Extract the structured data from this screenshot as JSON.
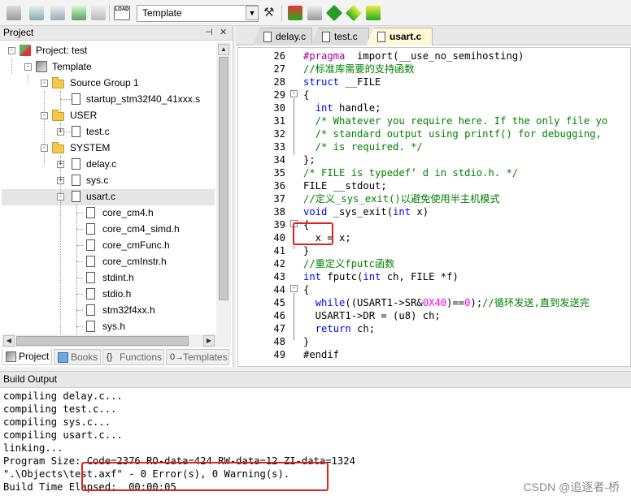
{
  "toolbar": {
    "target": "Template",
    "icons": [
      "translate-icon",
      "build-icon",
      "rebuild-icon",
      "batch-build-icon",
      "stop-build-icon",
      "download-icon",
      "options-icon",
      "manage-components-icon",
      "run-time-env-icon",
      "pack-installer-icon",
      "select-packs-icon"
    ]
  },
  "project": {
    "title": "Project",
    "tree": [
      {
        "label": "Project: test",
        "icon": "project-icon"
      },
      {
        "label": "Template",
        "icon": "target-icon"
      },
      {
        "label": "Source Group 1",
        "icon": "folder-icon"
      },
      {
        "label": "startup_stm32f40_41xxx.s",
        "icon": "file-icon"
      },
      {
        "label": "USER",
        "icon": "folder-icon"
      },
      {
        "label": "test.c",
        "icon": "file-icon"
      },
      {
        "label": "SYSTEM",
        "icon": "folder-icon"
      },
      {
        "label": "delay.c",
        "icon": "file-icon"
      },
      {
        "label": "sys.c",
        "icon": "file-icon"
      },
      {
        "label": "usart.c",
        "icon": "file-icon"
      },
      {
        "label": "core_cm4.h",
        "icon": "file-icon"
      },
      {
        "label": "core_cm4_simd.h",
        "icon": "file-icon"
      },
      {
        "label": "core_cmFunc.h",
        "icon": "file-icon"
      },
      {
        "label": "core_cmInstr.h",
        "icon": "file-icon"
      },
      {
        "label": "stdint.h",
        "icon": "file-icon"
      },
      {
        "label": "stdio.h",
        "icon": "file-icon"
      },
      {
        "label": "stm32f4xx.h",
        "icon": "file-icon"
      },
      {
        "label": "sys.h",
        "icon": "file-icon"
      }
    ],
    "tabs": [
      "Project",
      "Books",
      "Functions",
      "Templates"
    ]
  },
  "editor": {
    "tabs": [
      "delay.c",
      "test.c",
      "usart.c"
    ],
    "active_tab": "usart.c",
    "line_numbers": [
      "26",
      "27",
      "28",
      "29",
      "30",
      "31",
      "32",
      "33",
      "34",
      "35",
      "36",
      "37",
      "38",
      "39",
      "40",
      "41",
      "42",
      "43",
      "44",
      "45",
      "46",
      "47",
      "48",
      "49"
    ],
    "lines": [
      {
        "seg": [
          [
            "pp",
            "#pragma"
          ],
          [
            "",
            "  import(__use_no_semihosting)"
          ]
        ]
      },
      {
        "seg": [
          [
            "cm",
            "//标准库需要的支持函数"
          ]
        ]
      },
      {
        "seg": [
          [
            "kw",
            "struct"
          ],
          [
            "",
            " __FILE"
          ]
        ]
      },
      {
        "seg": [
          [
            "",
            "{"
          ]
        ]
      },
      {
        "seg": [
          [
            "",
            "  "
          ],
          [
            "kw",
            "int"
          ],
          [
            "",
            " handle;"
          ]
        ]
      },
      {
        "seg": [
          [
            "cm",
            "  /* Whatever you require here. If the only file yo"
          ]
        ]
      },
      {
        "seg": [
          [
            "cm",
            "  /* standard output using printf() for debugging,"
          ]
        ]
      },
      {
        "seg": [
          [
            "cm",
            "  /* is required. */"
          ]
        ]
      },
      {
        "seg": [
          [
            "",
            "};"
          ]
        ]
      },
      {
        "seg": [
          [
            "cm",
            "/* FILE is typedef’ d in stdio.h. */"
          ]
        ]
      },
      {
        "seg": [
          [
            "",
            "FILE __stdout;"
          ]
        ]
      },
      {
        "seg": [
          [
            "cm",
            "//定义_sys_exit()以避免使用半主机模式"
          ]
        ]
      },
      {
        "seg": [
          [
            "kw",
            "void"
          ],
          [
            "",
            " _sys_exit("
          ],
          [
            "kw",
            "int"
          ],
          [
            "",
            " x)"
          ]
        ]
      },
      {
        "seg": [
          [
            "",
            "{"
          ]
        ]
      },
      {
        "seg": [
          [
            "",
            "  x = x;"
          ]
        ]
      },
      {
        "seg": [
          [
            "",
            "}"
          ]
        ]
      },
      {
        "seg": [
          [
            "cm",
            "//重定义fputc函数"
          ]
        ]
      },
      {
        "seg": [
          [
            "kw",
            "int"
          ],
          [
            "",
            " fputc("
          ],
          [
            "kw",
            "int"
          ],
          [
            "",
            " ch, FILE *f)"
          ]
        ]
      },
      {
        "seg": [
          [
            "",
            "{"
          ]
        ]
      },
      {
        "seg": [
          [
            "",
            "  "
          ],
          [
            "kw",
            "while"
          ],
          [
            "",
            "((USART1->SR&"
          ],
          [
            "num",
            "0X40"
          ],
          [
            "",
            ")=="
          ],
          [
            "num",
            "0"
          ],
          [
            "",
            ");"
          ],
          [
            "cm",
            "//循环发送,直到发送完"
          ]
        ]
      },
      {
        "seg": [
          [
            "",
            "  USART1->DR = (u8) ch;"
          ]
        ]
      },
      {
        "seg": [
          [
            "",
            "  "
          ],
          [
            "kw",
            "return"
          ],
          [
            "",
            " ch;"
          ]
        ]
      },
      {
        "seg": [
          [
            "",
            "}"
          ]
        ]
      },
      {
        "seg": [
          [
            "",
            "#endif"
          ]
        ]
      }
    ]
  },
  "build": {
    "title": "Build Output",
    "lines": [
      "compiling delay.c...",
      "compiling test.c...",
      "compiling sys.c...",
      "compiling usart.c...",
      "linking...",
      "Program Size: Code=2376 RO-data=424 RW-data=12 ZI-data=1324",
      "\".\\Objects\\test.axf\" - 0 Error(s), 0 Warning(s).",
      "Build Time Elapsed:  00:00:05"
    ]
  },
  "watermark": "CSDN @追逐者-桥"
}
